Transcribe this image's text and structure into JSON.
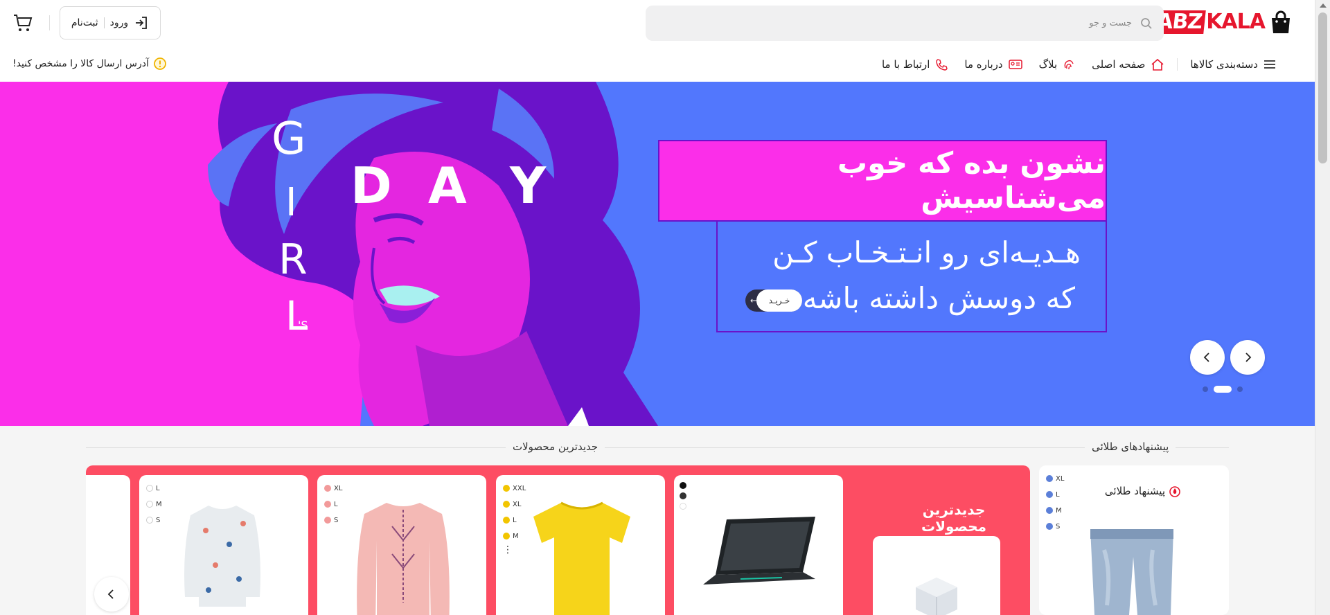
{
  "brand": {
    "part1": "NABZ",
    "part2": "KALA",
    "color": "#e6162d"
  },
  "search": {
    "placeholder": "جست و جو"
  },
  "auth": {
    "login_label": "ورود",
    "register_label": "ثبت‌نام"
  },
  "nav": {
    "items": [
      {
        "label": "دسته‌بندی کالاها",
        "icon": "menu-icon"
      },
      {
        "label": "صفحه اصلی",
        "icon": "home-icon"
      },
      {
        "label": "بلاگ",
        "icon": "fingerprint-icon"
      },
      {
        "label": "درباره ما",
        "icon": "id-card-icon"
      },
      {
        "label": "ارتباط با ما",
        "icon": "phone-icon"
      }
    ],
    "address_notice": "آدرس ارسال کالا را مشخص کنید!"
  },
  "banner": {
    "headline": "نشون بده که خوب می‌شناسیش",
    "line1": "هـدیـه‌ای رو انـتـخـاب کـن",
    "line2": "که دوسش داشته باشه",
    "cta": "خـریـد",
    "side_letters": [
      "G",
      "I",
      "R",
      "L"
    ],
    "apostrophe": "'S",
    "day_letters": [
      "D",
      "A",
      "Y"
    ],
    "colors": {
      "bg": "#5277fd",
      "magenta": "#fb2ee9",
      "purple": "#6a13c9"
    },
    "slide_count": 3,
    "active_slide": 2
  },
  "sections": {
    "golden": {
      "title": "پیشنهادهای طلائی",
      "card_heading": "پیشنهاد طلائی",
      "sizes": [
        "XL",
        "L",
        "M",
        "S"
      ]
    },
    "newest": {
      "title": "جدیدترین محصولات",
      "panel_heading": "جدیدترین محصولات",
      "products": [
        {
          "name": "laptop",
          "sizes": []
        },
        {
          "name": "yellow-tshirt",
          "sizes": [
            "XXL",
            "XL",
            "L",
            "M"
          ]
        },
        {
          "name": "pink-blouse",
          "sizes": [
            "XL",
            "L",
            "S"
          ]
        },
        {
          "name": "floral-blouse",
          "sizes": [
            "L",
            "M",
            "S"
          ]
        }
      ]
    }
  }
}
